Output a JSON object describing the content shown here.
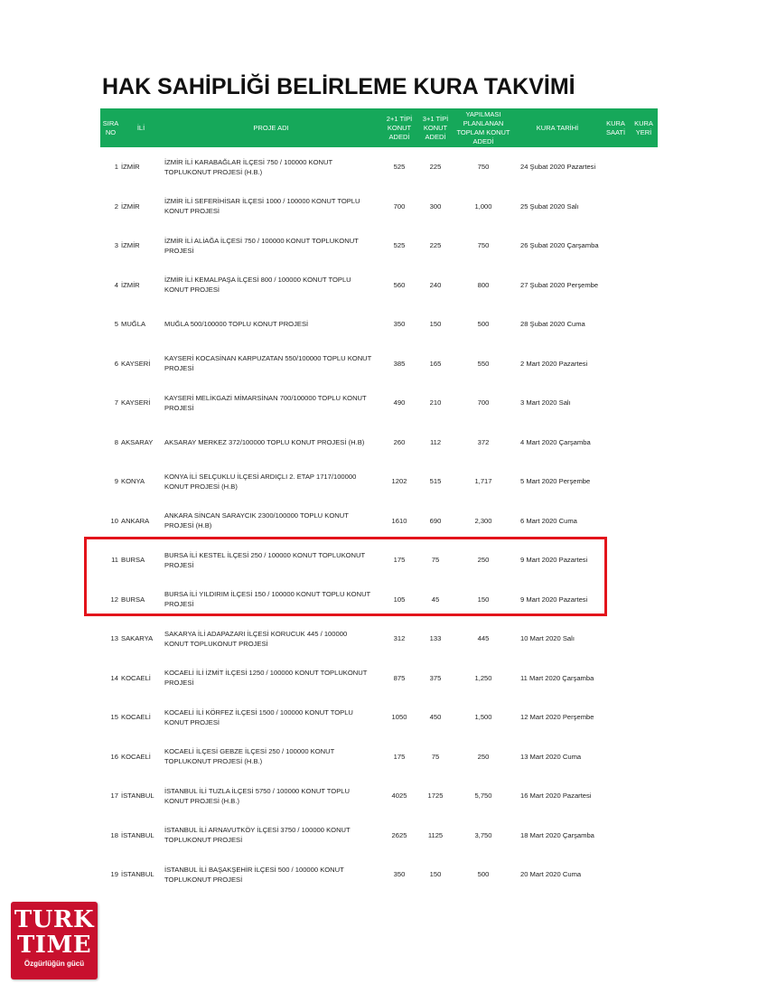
{
  "title": "HAK SAHİPLİĞİ BELİRLEME KURA TAKVİMİ",
  "columns": {
    "sira": [
      "SIRA",
      "NO"
    ],
    "il": "İLİ",
    "proje": "PROJE ADI",
    "tip21": [
      "2+1 TİPİ",
      "KONUT",
      "ADEDİ"
    ],
    "tip31": [
      "3+1 TİPİ",
      "KONUT",
      "ADEDİ"
    ],
    "toplam": [
      "YAPILMASI",
      "PLANLANAN",
      "TOPLAM KONUT",
      "ADEDİ"
    ],
    "tarih": "KURA TARİHİ",
    "saat": [
      "KURA",
      "SAATİ"
    ],
    "yer": [
      "KURA",
      "YERİ"
    ]
  },
  "rows": [
    {
      "no": "1",
      "il": "İZMİR",
      "proje": "İZMİR İLİ KARABAĞLAR İLÇESİ 750 / 100000 KONUT TOPLUKONUT PROJESİ (H.B.)",
      "t21": "525",
      "t31": "225",
      "toplam": "750",
      "tarih": "24 Şubat 2020 Pazartesi",
      "saat": "",
      "yer": ""
    },
    {
      "no": "2",
      "il": "İZMİR",
      "proje": "İZMİR İLİ SEFERİHİSAR İLÇESİ 1000 / 100000 KONUT TOPLU KONUT PROJESİ",
      "t21": "700",
      "t31": "300",
      "toplam": "1,000",
      "tarih": "25 Şubat 2020 Salı",
      "saat": "",
      "yer": ""
    },
    {
      "no": "3",
      "il": "İZMİR",
      "proje": "İZMİR İLİ ALİAĞA İLÇESİ 750 / 100000 KONUT TOPLUKONUT PROJESİ",
      "t21": "525",
      "t31": "225",
      "toplam": "750",
      "tarih": "26 Şubat 2020 Çarşamba",
      "saat": "",
      "yer": ""
    },
    {
      "no": "4",
      "il": "İZMİR",
      "proje": "İZMİR İLİ KEMALPAŞA İLÇESİ 800 / 100000 KONUT TOPLU KONUT PROJESİ",
      "t21": "560",
      "t31": "240",
      "toplam": "800",
      "tarih": "27 Şubat 2020 Perşembe",
      "saat": "",
      "yer": ""
    },
    {
      "no": "5",
      "il": "MUĞLA",
      "proje": "MUĞLA 500/100000 TOPLU KONUT PROJESİ",
      "t21": "350",
      "t31": "150",
      "toplam": "500",
      "tarih": "28 Şubat 2020 Cuma",
      "saat": "",
      "yer": ""
    },
    {
      "no": "6",
      "il": "KAYSERİ",
      "proje": "KAYSERİ KOCASİNAN KARPUZATAN 550/100000 TOPLU KONUT PROJESİ",
      "t21": "385",
      "t31": "165",
      "toplam": "550",
      "tarih": "2 Mart 2020 Pazartesi",
      "saat": "",
      "yer": ""
    },
    {
      "no": "7",
      "il": "KAYSERİ",
      "proje": "KAYSERİ MELİKGAZİ MİMARSİNAN 700/100000 TOPLU KONUT PROJESİ",
      "t21": "490",
      "t31": "210",
      "toplam": "700",
      "tarih": "3 Mart 2020 Salı",
      "saat": "",
      "yer": ""
    },
    {
      "no": "8",
      "il": "AKSARAY",
      "proje": "AKSARAY MERKEZ 372/100000 TOPLU KONUT PROJESİ (H.B)",
      "t21": "260",
      "t31": "112",
      "toplam": "372",
      "tarih": "4 Mart 2020 Çarşamba",
      "saat": "",
      "yer": ""
    },
    {
      "no": "9",
      "il": "KONYA",
      "proje": "KONYA İLİ SELÇUKLU İLÇESİ ARDIÇLI 2. ETAP 1717/100000 KONUT PROJESİ (H.B)",
      "t21": "1202",
      "t31": "515",
      "toplam": "1,717",
      "tarih": "5 Mart 2020 Perşembe",
      "saat": "",
      "yer": ""
    },
    {
      "no": "10",
      "il": "ANKARA",
      "proje": "ANKARA SİNCAN SARAYCIK 2300/100000 TOPLU KONUT PROJESİ (H.B)",
      "t21": "1610",
      "t31": "690",
      "toplam": "2,300",
      "tarih": "6 Mart 2020 Cuma",
      "saat": "",
      "yer": ""
    },
    {
      "no": "11",
      "il": "BURSA",
      "proje": "BURSA İLİ KESTEL İLÇESİ 250 / 100000 KONUT TOPLUKONUT PROJESİ",
      "t21": "175",
      "t31": "75",
      "toplam": "250",
      "tarih": "9 Mart 2020 Pazartesi",
      "saat": "",
      "yer": ""
    },
    {
      "no": "12",
      "il": "BURSA",
      "proje": "BURSA İLİ YILDIRIM İLÇESİ 150 / 100000 KONUT TOPLU KONUT PROJESİ",
      "t21": "105",
      "t31": "45",
      "toplam": "150",
      "tarih": "9 Mart 2020 Pazartesi",
      "saat": "",
      "yer": ""
    },
    {
      "no": "13",
      "il": "SAKARYA",
      "proje": "SAKARYA İLİ ADAPAZARI İLÇESİ KORUCUK 445 / 100000 KONUT TOPLUKONUT PROJESİ",
      "t21": "312",
      "t31": "133",
      "toplam": "445",
      "tarih": "10 Mart 2020 Salı",
      "saat": "",
      "yer": ""
    },
    {
      "no": "14",
      "il": "KOCAELİ",
      "proje": "KOCAELİ İLİ İZMİT İLÇESİ 1250 / 100000 KONUT TOPLUKONUT PROJESİ",
      "t21": "875",
      "t31": "375",
      "toplam": "1,250",
      "tarih": "11 Mart 2020 Çarşamba",
      "saat": "",
      "yer": ""
    },
    {
      "no": "15",
      "il": "KOCAELİ",
      "proje": "KOCAELİ İLİ KÖRFEZ İLÇESİ  1500 / 100000 KONUT TOPLU KONUT PROJESİ",
      "t21": "1050",
      "t31": "450",
      "toplam": "1,500",
      "tarih": "12 Mart 2020 Perşembe",
      "saat": "",
      "yer": ""
    },
    {
      "no": "16",
      "il": "KOCAELİ",
      "proje": "KOCAELİ İLÇESİ GEBZE İLÇESİ 250 / 100000 KONUT TOPLUKONUT PROJESİ (H.B.)",
      "t21": "175",
      "t31": "75",
      "toplam": "250",
      "tarih": "13 Mart 2020 Cuma",
      "saat": "",
      "yer": ""
    },
    {
      "no": "17",
      "il": "İSTANBUL",
      "proje": "İSTANBUL İLİ TUZLA İLÇESİ 5750 / 100000 KONUT TOPLU KONUT PROJESİ (H.B.)",
      "t21": "4025",
      "t31": "1725",
      "toplam": "5,750",
      "tarih": "16 Mart 2020 Pazartesi",
      "saat": "",
      "yer": ""
    },
    {
      "no": "18",
      "il": "İSTANBUL",
      "proje": "İSTANBUL İLİ ARNAVUTKÖY İLÇESİ 3750 / 100000 KONUT TOPLUKONUT PROJESİ",
      "t21": "2625",
      "t31": "1125",
      "toplam": "3,750",
      "tarih": "18 Mart 2020 Çarşamba",
      "saat": "",
      "yer": ""
    },
    {
      "no": "19",
      "il": "İSTANBUL",
      "proje": "İSTANBUL İLİ BAŞAKŞEHİR İLÇESİ  500 / 100000 KONUT TOPLUKONUT PROJESİ",
      "t21": "350",
      "t31": "150",
      "toplam": "500",
      "tarih": "20 Mart 2020 Cuma",
      "saat": "",
      "yer": ""
    }
  ],
  "highlight_color": "#e3141b",
  "header_color": "#16a85a",
  "logo": {
    "line1": "TURK",
    "line2": "TIME",
    "tagline": "Özgürlüğün gücü",
    "color": "#c8102e"
  }
}
